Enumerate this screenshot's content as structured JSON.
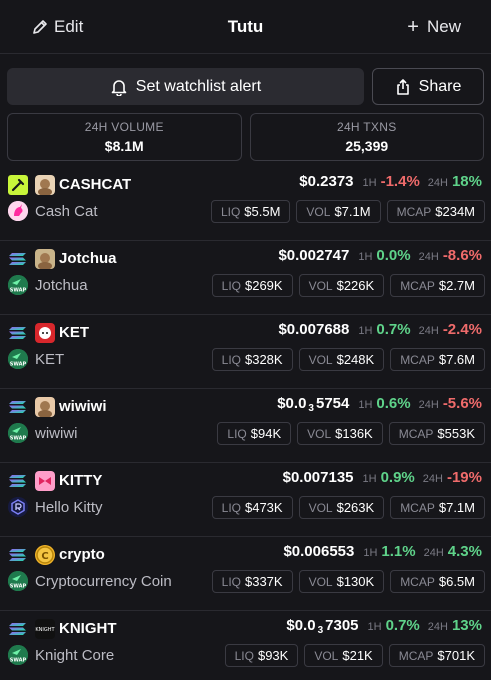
{
  "header": {
    "edit_label": "Edit",
    "title": "Tutu",
    "new_label": "New"
  },
  "actions": {
    "alert_label": "Set watchlist alert",
    "share_label": "Share"
  },
  "stats": {
    "volume_label": "24H VOLUME",
    "volume_value": "$8.1M",
    "txns_label": "24H TXNS",
    "txns_value": "25,399"
  },
  "labels": {
    "h1": "1H",
    "h24": "24H",
    "liq": "LIQ",
    "vol": "VOL",
    "mcap": "MCAP",
    "swap": "SWAP"
  },
  "tokens": [
    {
      "symbol": "CASHCAT",
      "name": "Cash Cat",
      "price": "$0.2373",
      "change_1h": "-1.4%",
      "change_24h": "18%",
      "liq": "$5.5M",
      "vol": "$7.1M",
      "mcap": "$234M",
      "chain_icon": "pump-icon",
      "dex_icon": "unicorn-icon"
    },
    {
      "symbol": "Jotchua",
      "name": "Jotchua",
      "price": "$0.002747",
      "change_1h": "0.0%",
      "change_24h": "-8.6%",
      "liq": "$269K",
      "vol": "$226K",
      "mcap": "$2.7M",
      "chain_icon": "solana-icon",
      "dex_icon": "swap-icon"
    },
    {
      "symbol": "KET",
      "name": "KET",
      "price": "$0.007688",
      "change_1h": "0.7%",
      "change_24h": "-2.4%",
      "liq": "$328K",
      "vol": "$248K",
      "mcap": "$7.6M",
      "chain_icon": "solana-icon",
      "dex_icon": "swap-icon"
    },
    {
      "symbol": "wiwiwi",
      "name": "wiwiwi",
      "price_prefix": "$0.0",
      "price_sub": "3",
      "price_rest": "5754",
      "change_1h": "0.6%",
      "change_24h": "-5.6%",
      "liq": "$94K",
      "vol": "$136K",
      "mcap": "$553K",
      "chain_icon": "solana-icon",
      "dex_icon": "swap-icon"
    },
    {
      "symbol": "KITTY",
      "name": "Hello Kitty",
      "price": "$0.007135",
      "change_1h": "0.9%",
      "change_24h": "-19%",
      "liq": "$473K",
      "vol": "$263K",
      "mcap": "$7.1M",
      "chain_icon": "solana-icon",
      "dex_icon": "raydium-icon"
    },
    {
      "symbol": "crypto",
      "name": "Cryptocurrency Coin",
      "price": "$0.006553",
      "change_1h": "1.1%",
      "change_24h": "4.3%",
      "liq": "$337K",
      "vol": "$130K",
      "mcap": "$6.5M",
      "chain_icon": "solana-icon",
      "dex_icon": "swap-icon"
    },
    {
      "symbol": "KNIGHT",
      "name": "Knight Core",
      "price_prefix": "$0.0",
      "price_sub": "3",
      "price_rest": "7305",
      "change_1h": "0.7%",
      "change_24h": "13%",
      "liq": "$93K",
      "vol": "$21K",
      "mcap": "$701K",
      "chain_icon": "solana-icon",
      "dex_icon": "swap-icon"
    }
  ],
  "colors": {
    "positive": "#5fd38a",
    "negative": "#ef6b6b",
    "background": "#16161a"
  }
}
